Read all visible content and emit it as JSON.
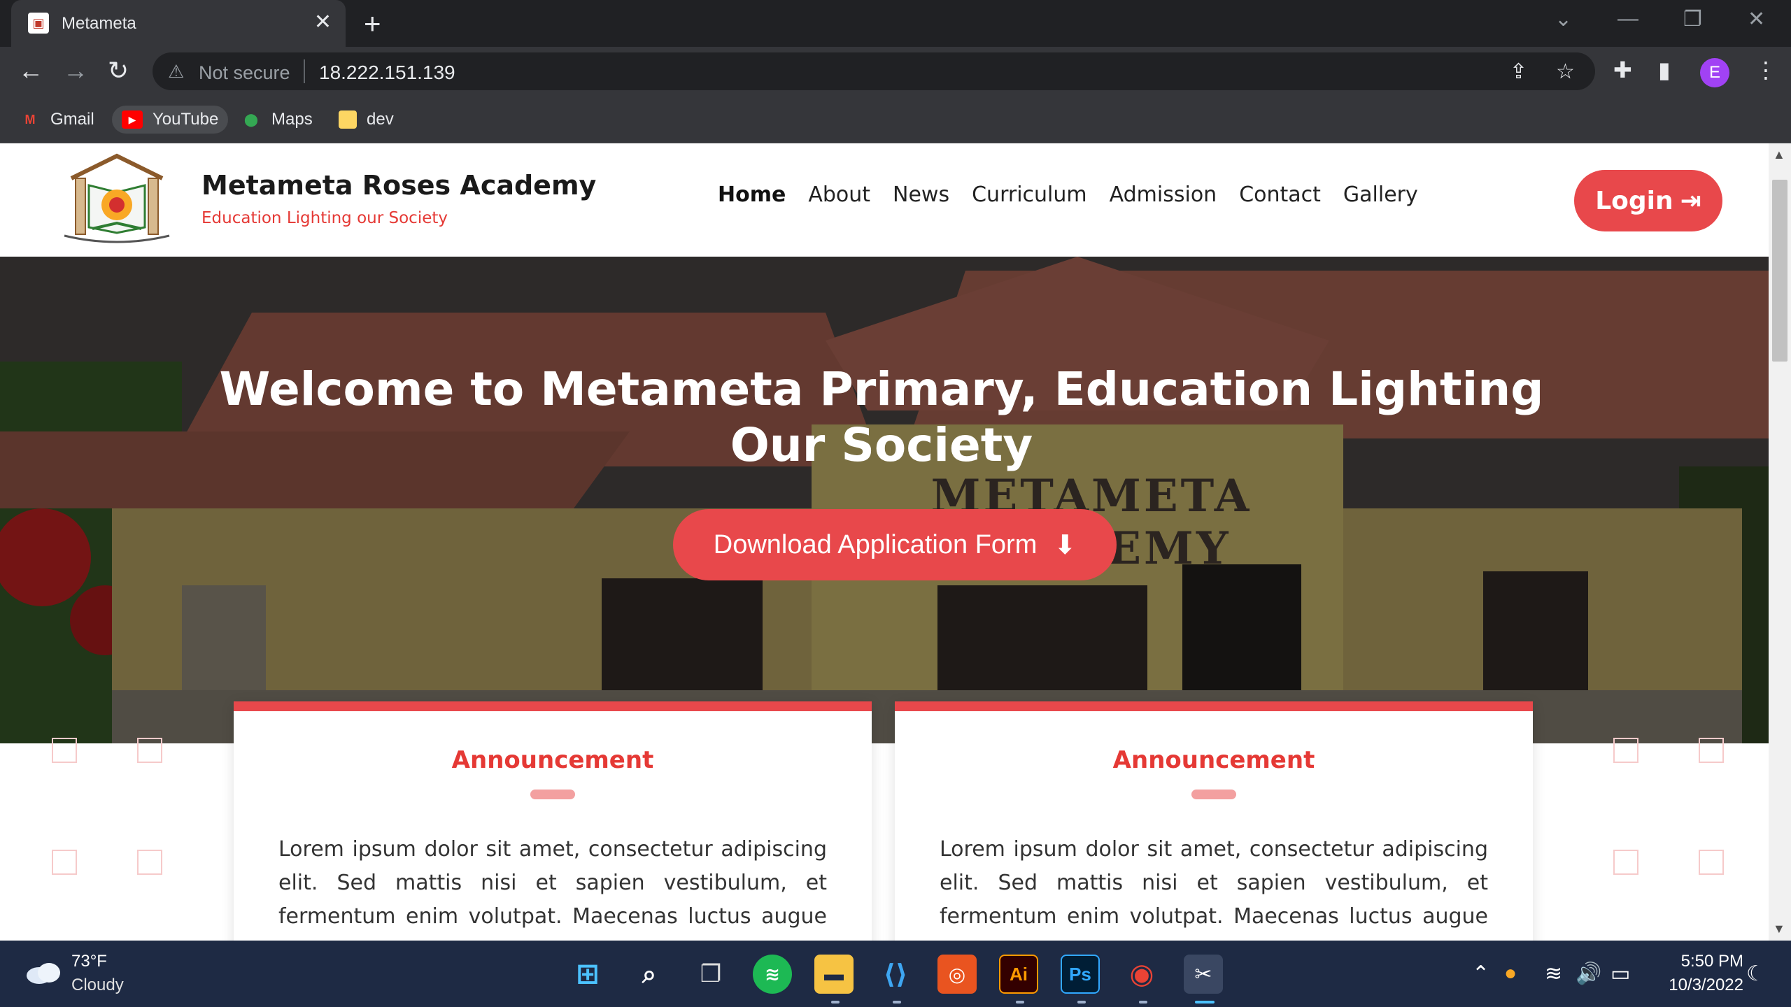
{
  "browser": {
    "tab_title": "Metameta",
    "tab_close": "✕",
    "new_tab": "+",
    "security_label": "Not secure",
    "url": "18.222.151.139",
    "avatar_letter": "E",
    "bookmarks": [
      {
        "label": "Gmail",
        "icon": "gmail-icon"
      },
      {
        "label": "YouTube",
        "icon": "youtube-icon"
      },
      {
        "label": "Maps",
        "icon": "maps-icon"
      },
      {
        "label": "dev",
        "icon": "folder-icon"
      }
    ]
  },
  "site": {
    "brand_name": "Metameta Roses Academy",
    "tagline": "Education Lighting our Society",
    "nav": [
      "Home",
      "About",
      "News",
      "Curriculum",
      "Admission",
      "Contact",
      "Gallery"
    ],
    "active_nav": "Home",
    "login_label": "Login",
    "hero_title": "Welcome to Metameta Primary, Education Lighting Our Society",
    "hero_sign": "METAMETA ACADEMY",
    "download_label": "Download Application Form",
    "cards": [
      {
        "title": "Announcement",
        "text": "Lorem ipsum dolor sit amet, consectetur adipiscing elit. Sed mattis nisi et sapien vestibulum, et fermentum enim volutpat. Maecenas luctus augue nec"
      },
      {
        "title": "Announcement",
        "text": "Lorem ipsum dolor sit amet, consectetur adipiscing elit. Sed mattis nisi et sapien vestibulum, et fermentum enim volutpat. Maecenas luctus augue nec"
      }
    ],
    "accent_color": "#e8484b"
  },
  "taskbar": {
    "temperature": "73°F",
    "condition": "Cloudy",
    "time": "5:50 PM",
    "date": "10/3/2022",
    "apps": [
      "windows-start",
      "search",
      "task-view",
      "spotify",
      "file-explorer",
      "vscode",
      "ubuntu",
      "illustrator",
      "photoshop",
      "chrome",
      "snipping-tool"
    ]
  }
}
